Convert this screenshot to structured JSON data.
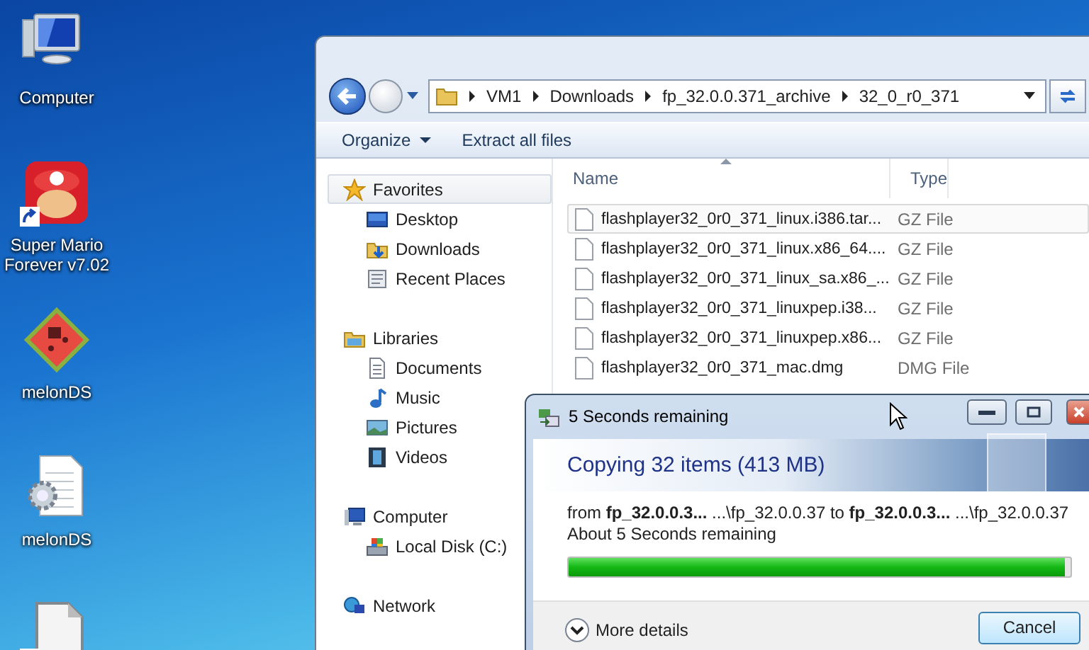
{
  "desktop_icons": [
    {
      "kind": "computer",
      "label": "Computer",
      "shortcut": false
    },
    {
      "kind": "game",
      "label": "Super Mario Forever v7.02",
      "shortcut": true
    },
    {
      "kind": "emulator",
      "label": "melonDS",
      "shortcut": false
    },
    {
      "kind": "config-file",
      "label": "melonDS",
      "shortcut": false
    },
    {
      "kind": "document",
      "shortcut": true
    }
  ],
  "explorer": {
    "breadcrumb": [
      "VM1",
      "Downloads",
      "fp_32.0.0.371_archive",
      "32_0_r0_371"
    ],
    "toolbar": [
      {
        "label": "Organize",
        "kind": "menu"
      },
      {
        "label": "Extract all files",
        "kind": "plain"
      }
    ],
    "nav": [
      {
        "label": "Favorites",
        "kind": "star",
        "selected": true,
        "children": [
          {
            "label": "Desktop",
            "kind": "desktop",
            "selected": false
          },
          {
            "label": "Downloads",
            "kind": "downloads",
            "selected": false
          },
          {
            "label": "Recent Places",
            "kind": "recent",
            "selected": false
          }
        ]
      },
      {
        "label": "Libraries",
        "kind": "library",
        "selected": false,
        "children": [
          {
            "label": "Documents",
            "kind": "documents",
            "selected": false
          },
          {
            "label": "Music",
            "kind": "music",
            "selected": false
          },
          {
            "label": "Pictures",
            "kind": "pictures",
            "selected": false
          },
          {
            "label": "Videos",
            "kind": "videos",
            "selected": false
          }
        ]
      },
      {
        "label": "Computer",
        "kind": "computer",
        "selected": false,
        "children": [
          {
            "label": "Local Disk (C:)",
            "kind": "disk",
            "selected": false
          }
        ]
      },
      {
        "label": "Network",
        "kind": "network",
        "selected": false
      }
    ],
    "columns": [
      {
        "label": "Name",
        "sorted": true
      },
      {
        "label": "Type",
        "sorted": false
      }
    ],
    "rows": [
      {
        "name": "flashplayer32_0r0_371_linux.i386.tar...",
        "type": "GZ File",
        "selected": true
      },
      {
        "name": "flashplayer32_0r0_371_linux.x86_64....",
        "type": "GZ File",
        "selected": false
      },
      {
        "name": "flashplayer32_0r0_371_linux_sa.x86_...",
        "type": "GZ File",
        "selected": false
      },
      {
        "name": "flashplayer32_0r0_371_linuxpep.i38...",
        "type": "GZ File",
        "selected": false
      },
      {
        "name": "flashplayer32_0r0_371_linuxpep.x86...",
        "type": "GZ File",
        "selected": false
      },
      {
        "name": "flashplayer32_0r0_371_mac.dmg",
        "type": "DMG File",
        "selected": false
      }
    ]
  },
  "copy_dialog": {
    "title": "5 Seconds remaining",
    "heading": "Copying 32 items (413 MB)",
    "from_line": "from **fp_32.0.0.3...** ...\\fp_32.0.0.37 to **fp_32.0.0.3...** ...\\fp_32.0.0.37",
    "status": "About 5 Seconds remaining",
    "progress": {
      "level": 0.99
    },
    "details_button": "More details",
    "cancel_button": "Cancel"
  }
}
